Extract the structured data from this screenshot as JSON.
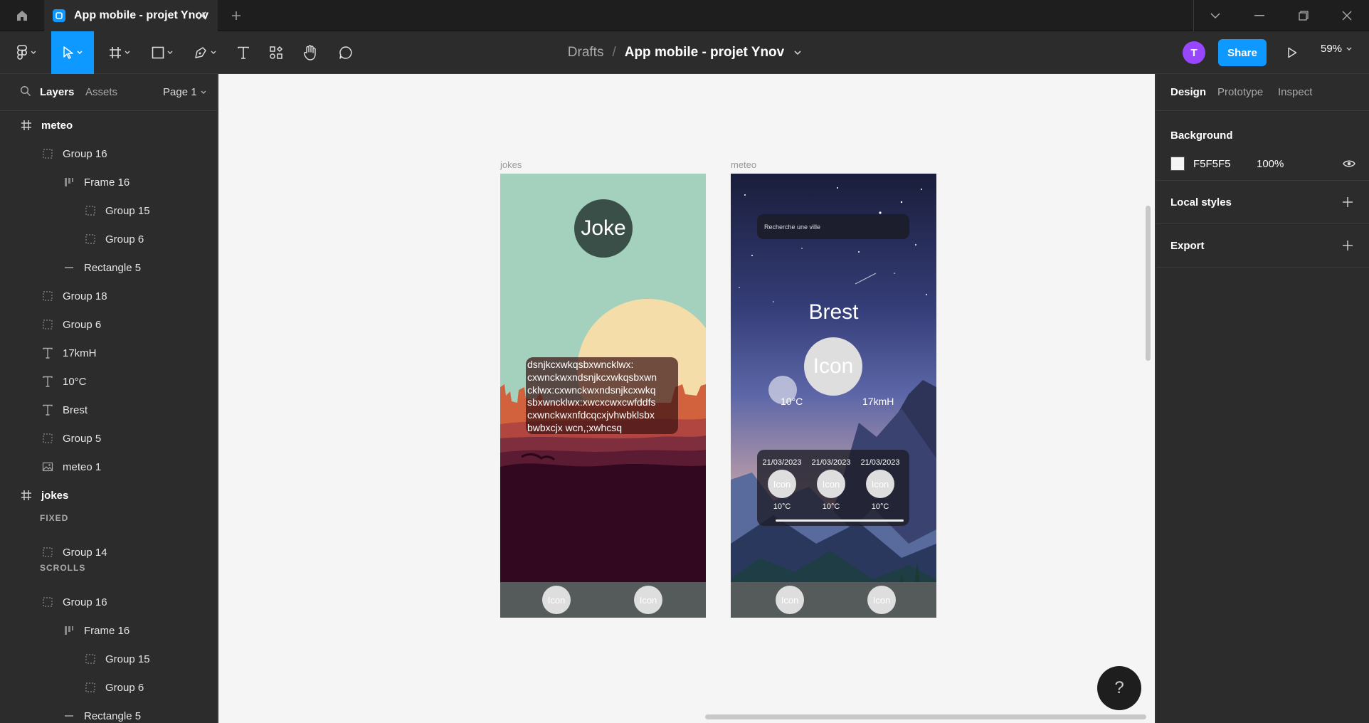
{
  "titlebar": {
    "tab_title": "App mobile - projet Ynov"
  },
  "toolbar": {
    "breadcrumb_root": "Drafts",
    "breadcrumb_sep": "/",
    "file_name": "App mobile - projet Ynov",
    "avatar_initial": "T",
    "share_label": "Share",
    "zoom": "59%"
  },
  "left_panel": {
    "tabs": {
      "layers": "Layers",
      "assets": "Assets",
      "page": "Page 1"
    },
    "layers": [
      {
        "label": "meteo",
        "type": "frame"
      },
      {
        "label": "Group 16",
        "type": "group"
      },
      {
        "label": "Frame 16",
        "type": "autolayout"
      },
      {
        "label": "Group 15",
        "type": "group"
      },
      {
        "label": "Group 6",
        "type": "group"
      },
      {
        "label": "Rectangle 5",
        "type": "rect"
      },
      {
        "label": "Group 18",
        "type": "group"
      },
      {
        "label": "Group 6",
        "type": "group"
      },
      {
        "label": "17kmH",
        "type": "text"
      },
      {
        "label": "10°C",
        "type": "text"
      },
      {
        "label": "Brest",
        "type": "text"
      },
      {
        "label": "Group 5",
        "type": "group"
      },
      {
        "label": "meteo 1",
        "type": "image"
      },
      {
        "label": "jokes",
        "type": "frame"
      },
      {
        "label": "FIXED",
        "type": "section"
      },
      {
        "label": "Group 14",
        "type": "group"
      },
      {
        "label": "SCROLLS",
        "type": "section"
      },
      {
        "label": "Group 16",
        "type": "group"
      },
      {
        "label": "Frame 16",
        "type": "autolayout"
      },
      {
        "label": "Group 15",
        "type": "group"
      },
      {
        "label": "Group 6",
        "type": "group"
      },
      {
        "label": "Rectangle 5",
        "type": "rect"
      }
    ]
  },
  "canvas": {
    "jokes_frame_label": "jokes",
    "meteo_frame_label": "meteo",
    "jokes": {
      "title": "Joke",
      "text": "dsnjkcxwkqsbxwncklwx:\ncxwnckwxndsnjkcxwkqsbxwn\ncklwx:cxwnckwxndsnjkcxwkq\nsbxwncklwx:xwcxcwxcwfddfs\ncxwnckwxnfdcqcxjvhwbklsbx\nbwbxcjx wcn,;xwhcsq",
      "nav_icon_1": "Icon",
      "nav_icon_2": "Icon"
    },
    "meteo": {
      "search_placeholder": "Recherche une ville",
      "city": "Brest",
      "main_icon": "Icon",
      "temp": "10°C",
      "wind": "17kmH",
      "forecast": [
        {
          "date": "21/03/2023",
          "icon": "Icon",
          "temp": "10°C"
        },
        {
          "date": "21/03/2023",
          "icon": "Icon",
          "temp": "10°C"
        },
        {
          "date": "21/03/2023",
          "icon": "Icon",
          "temp": "10°C"
        }
      ],
      "nav_icon_1": "Icon",
      "nav_icon_2": "Icon"
    }
  },
  "right_panel": {
    "tabs": {
      "design": "Design",
      "prototype": "Prototype",
      "inspect": "Inspect"
    },
    "background_title": "Background",
    "background_hex": "F5F5F5",
    "background_opacity": "100%",
    "local_styles_title": "Local styles",
    "export_title": "Export"
  },
  "help_label": "?",
  "colors": {
    "accent": "#0d99ff",
    "avatar": "#9747ff",
    "canvas_bg": "#f5f5f5"
  }
}
